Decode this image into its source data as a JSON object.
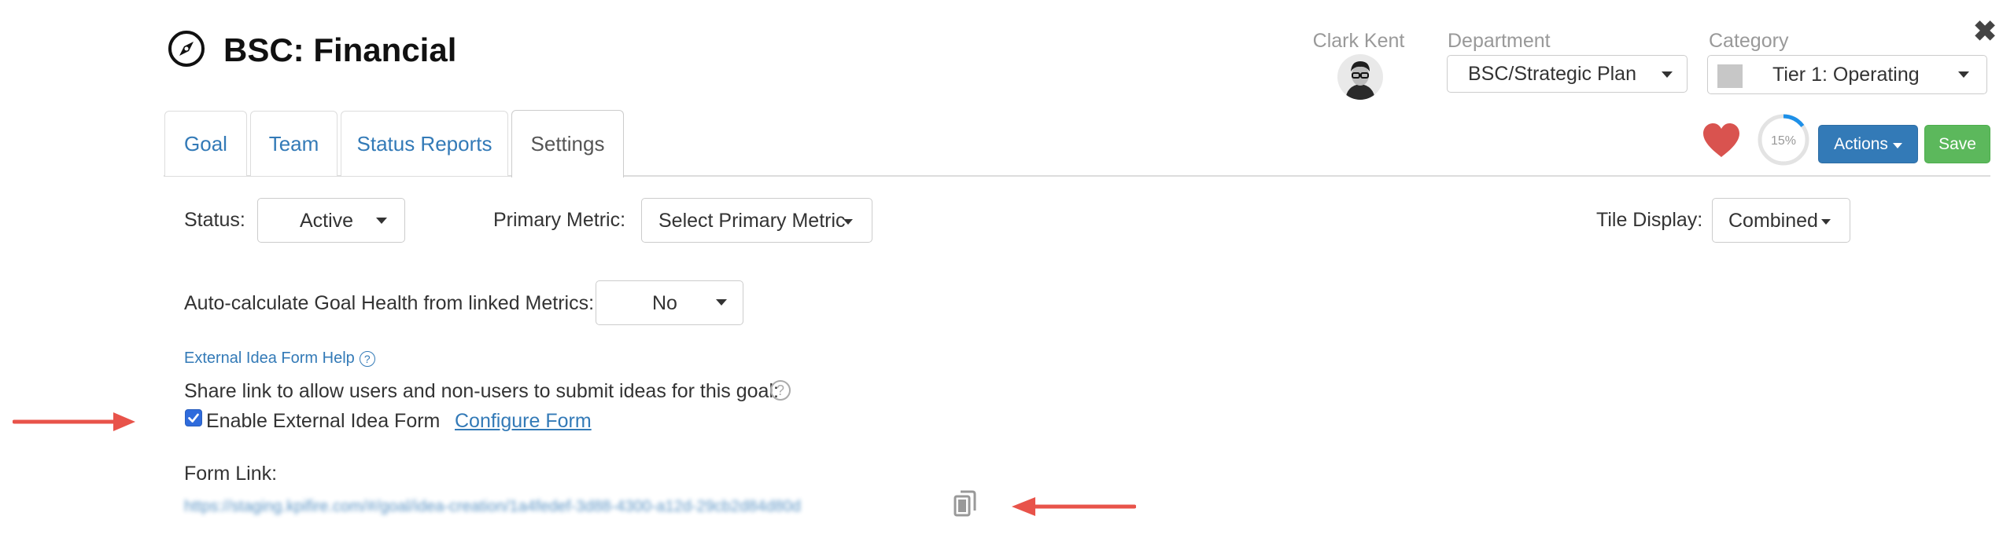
{
  "header": {
    "title": "BSC: Financial",
    "owner": {
      "name": "Clark Kent"
    },
    "department": {
      "label": "Department",
      "value": "BSC/Strategic Plan"
    },
    "category": {
      "label": "Category",
      "value": "Tier 1: Operating",
      "swatch_color": "#c7c7c7"
    },
    "close_symbol": "✖"
  },
  "tabs": [
    {
      "label": "Goal",
      "active": false
    },
    {
      "label": "Team",
      "active": false
    },
    {
      "label": "Status Reports",
      "active": false
    },
    {
      "label": "Settings",
      "active": true
    }
  ],
  "toolbar": {
    "favorite_color": "#d9534f",
    "progress": {
      "value": 0.15,
      "label": "15%"
    },
    "actions_label": "Actions",
    "save_label": "Save"
  },
  "settings": {
    "status": {
      "label": "Status:",
      "value": "Active"
    },
    "primary_metric": {
      "label": "Primary Metric:",
      "value": "Select Primary Metric"
    },
    "tile_display": {
      "label": "Tile Display:",
      "value": "Combined"
    },
    "auto_calc": {
      "label": "Auto-calculate Goal Health from linked Metrics:",
      "value": "No"
    },
    "help_link": "External Idea Form Help",
    "share_text": "Share link to allow users and non-users to submit ideas for this goal:",
    "enable_checkbox": {
      "label": "Enable External Idea Form",
      "checked": true
    },
    "configure_link": "Configure Form",
    "form_link": {
      "label": "Form Link:",
      "url": "https://staging.kpifire.com/#/goal/idea-creation/1a4fedef-3d88-4300-a12d-29cb2d84d80d"
    }
  },
  "annotation_arrow_color": "#e8534a",
  "icons": [
    "compass-icon",
    "close-icon",
    "heart-icon",
    "question-circle-icon",
    "copy-icon",
    "caret-down-icon"
  ]
}
